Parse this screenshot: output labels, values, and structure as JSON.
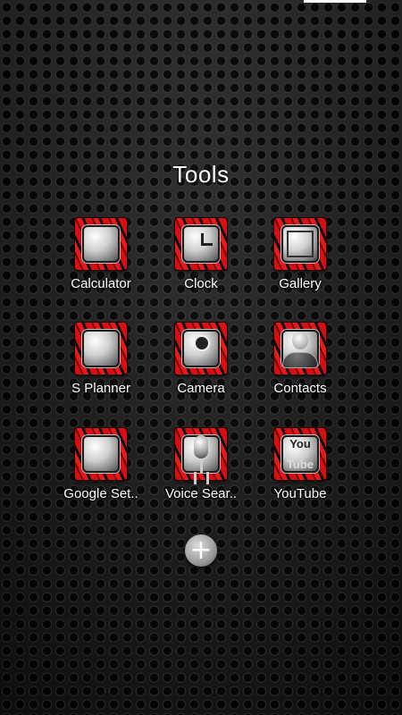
{
  "folder": {
    "title": "Tools",
    "add_label": "+"
  },
  "apps": [
    {
      "label": "Calculator",
      "icon": "calculator-icon"
    },
    {
      "label": "Clock",
      "icon": "clock-icon"
    },
    {
      "label": "Gallery",
      "icon": "gallery-icon"
    },
    {
      "label": "S Planner",
      "icon": "calendar-icon"
    },
    {
      "label": "Camera",
      "icon": "camera-icon"
    },
    {
      "label": "Contacts",
      "icon": "contacts-icon"
    },
    {
      "label": "Google Set..",
      "icon": "google-settings-icon"
    },
    {
      "label": "Voice Sear..",
      "icon": "microphone-icon"
    },
    {
      "label": "YouTube",
      "icon": "youtube-icon"
    }
  ],
  "youtube_icon_text": {
    "top": "You",
    "bottom": "Tube"
  },
  "colors": {
    "accent_red": "#d80f12",
    "text": "#ffffff",
    "background": "#151515"
  }
}
